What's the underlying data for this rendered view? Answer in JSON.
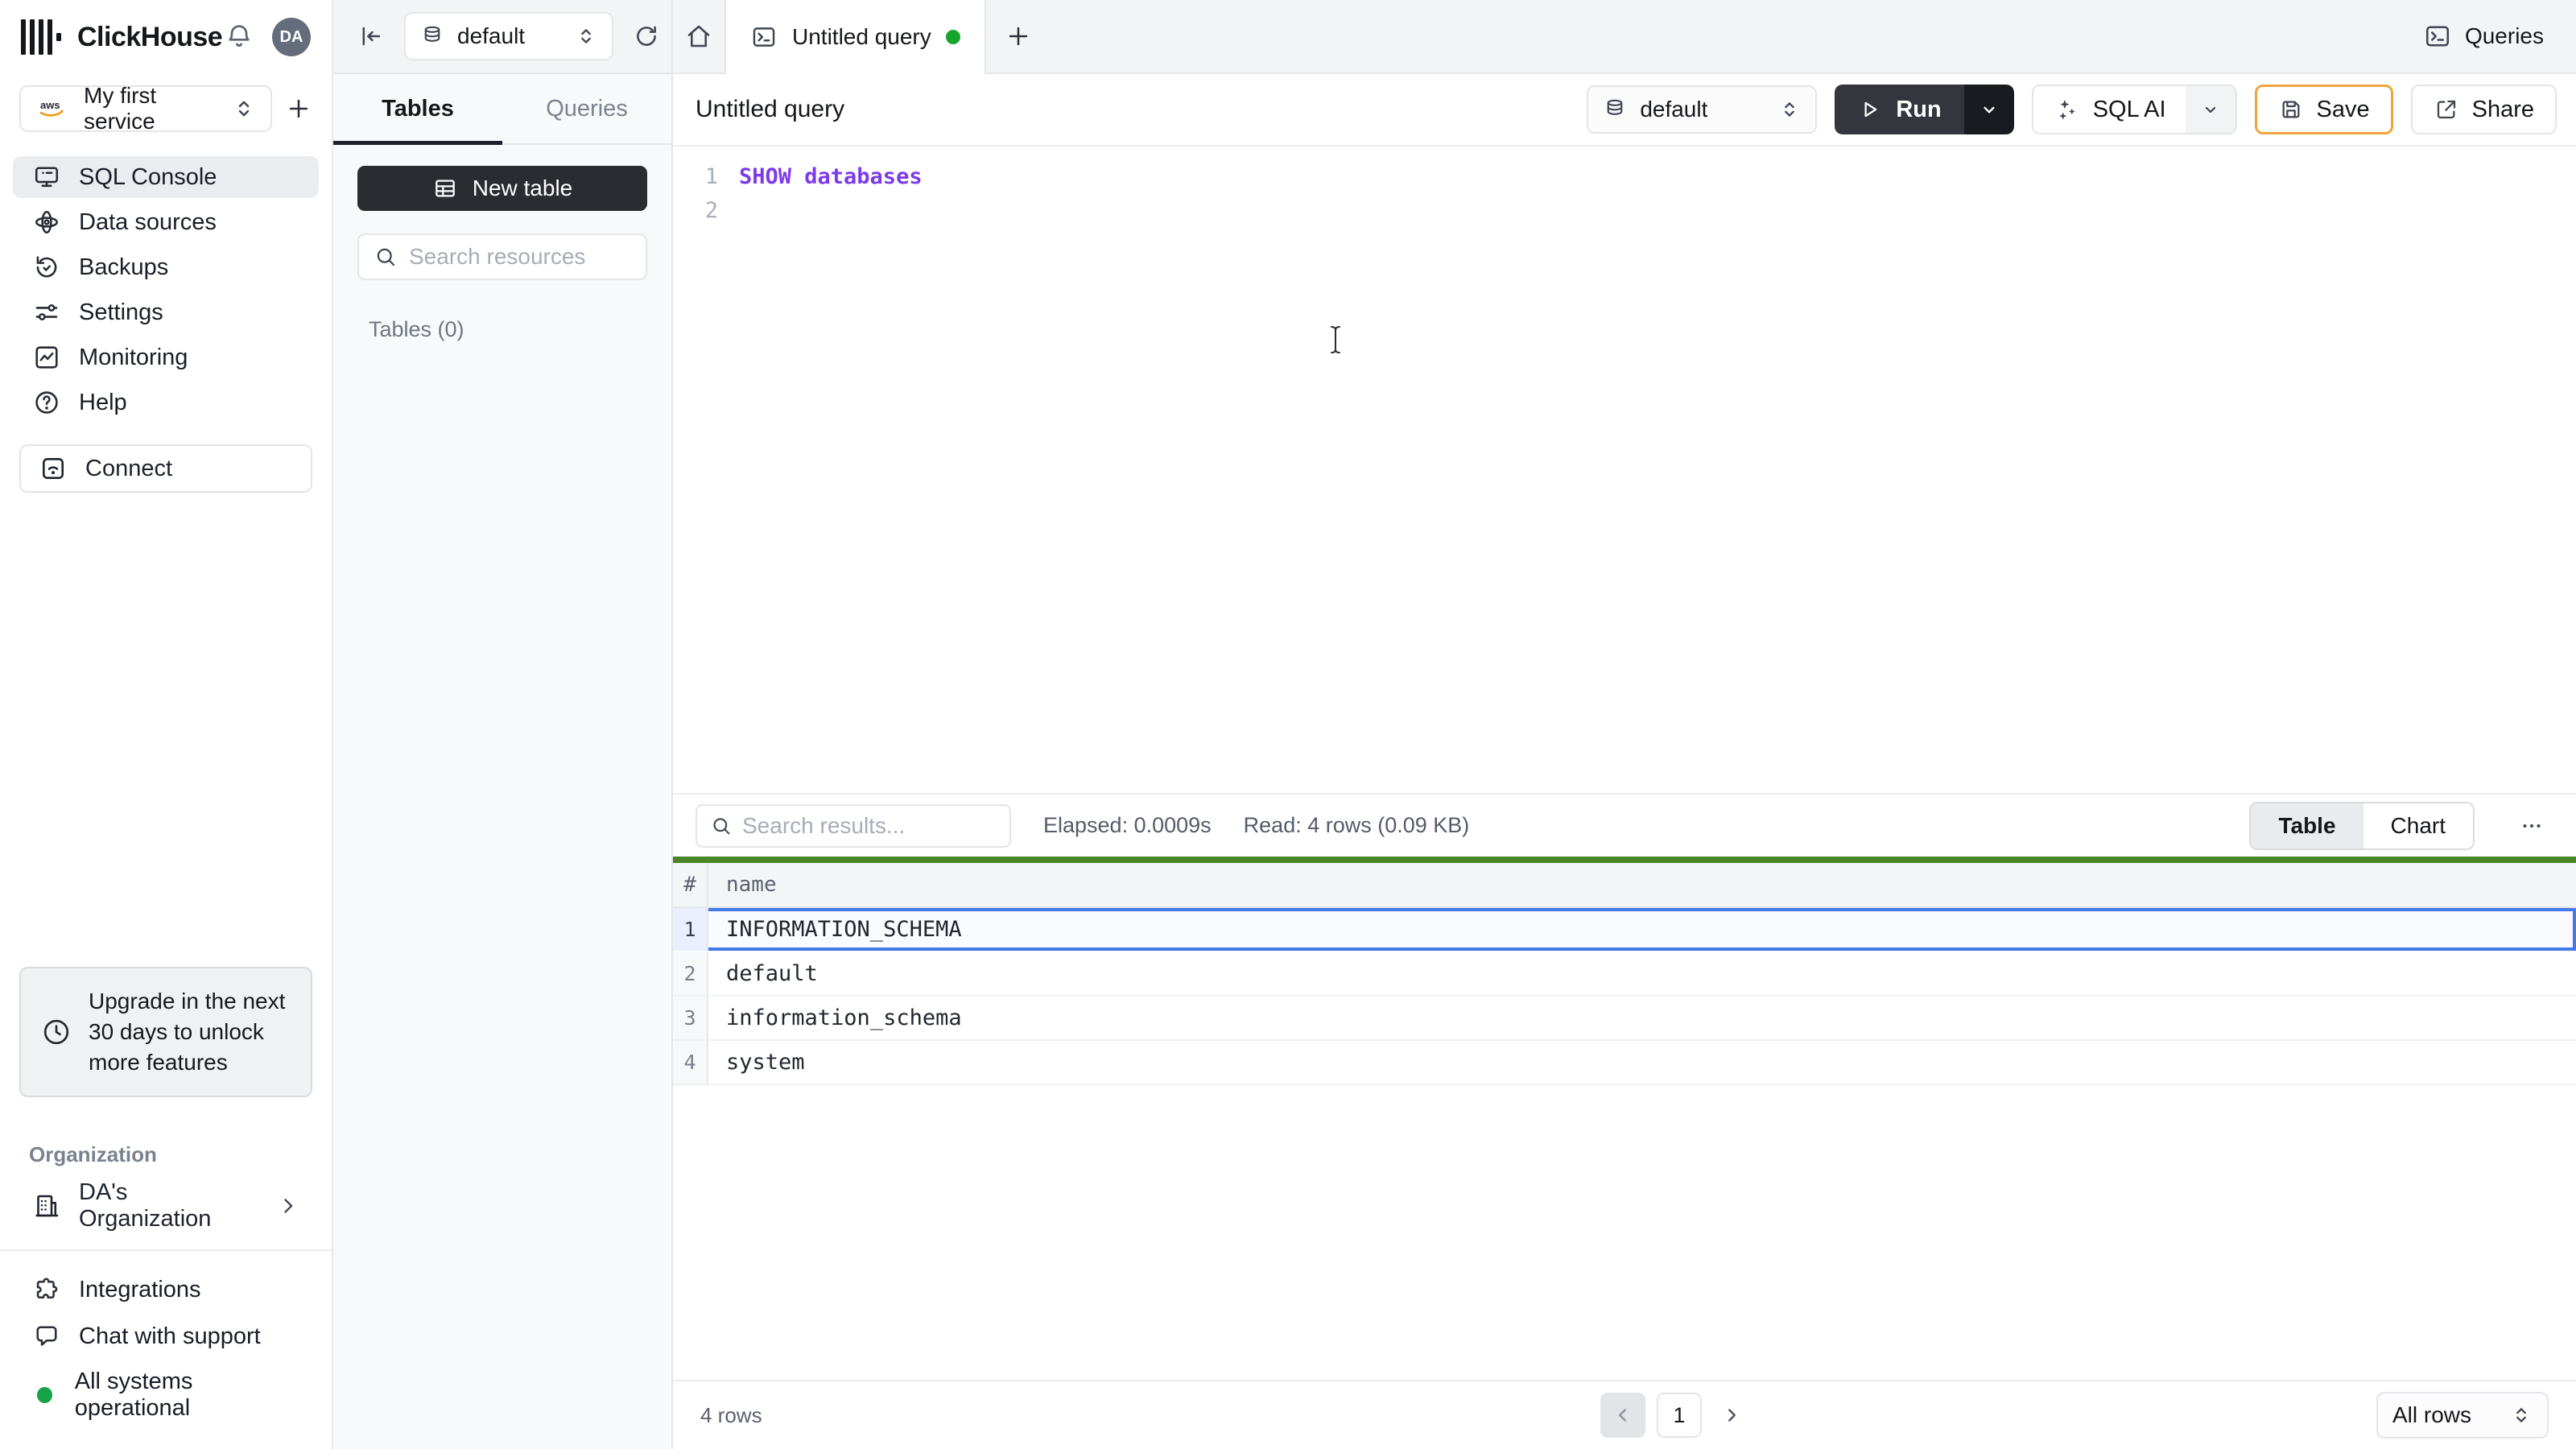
{
  "brand": {
    "name": "ClickHouse",
    "avatar_initials": "DA"
  },
  "sidebar": {
    "service_selector": {
      "label": "My first service",
      "provider_icon": "aws-icon"
    },
    "nav": [
      {
        "label": "SQL Console",
        "icon": "monitor-icon",
        "active": true
      },
      {
        "label": "Data sources",
        "icon": "atom-icon"
      },
      {
        "label": "Backups",
        "icon": "history-icon"
      },
      {
        "label": "Settings",
        "icon": "sliders-icon"
      },
      {
        "label": "Monitoring",
        "icon": "chart-square-icon"
      },
      {
        "label": "Help",
        "icon": "help-circle-icon"
      }
    ],
    "connect_label": "Connect",
    "upgrade_notice": "Upgrade in the next 30 days to unlock more features",
    "organization_section_label": "Organization",
    "organization_name": "DA's Organization",
    "footer": {
      "integrations": "Integrations",
      "chat_support": "Chat with support",
      "status": "All systems operational"
    }
  },
  "topbar": {
    "database_selector": "default",
    "active_tab": "Untitled query",
    "queries_button": "Queries"
  },
  "explorer": {
    "tab_tables": "Tables",
    "tab_queries": "Queries",
    "new_table_label": "New table",
    "search_placeholder": "Search resources",
    "tables_count": "Tables (0)"
  },
  "query": {
    "title": "Untitled query",
    "database_selector": "default",
    "run_label": "Run",
    "sql_ai_label": "SQL AI",
    "save_label": "Save",
    "share_label": "Share",
    "lines": [
      {
        "number": "1",
        "code": "SHOW databases"
      },
      {
        "number": "2",
        "code": ""
      }
    ]
  },
  "results": {
    "search_placeholder": "Search results...",
    "elapsed": "Elapsed: 0.0009s",
    "read": "Read: 4 rows (0.09 KB)",
    "view_table": "Table",
    "view_chart": "Chart",
    "columns": {
      "index": "#",
      "name": "name"
    },
    "rows": [
      {
        "n": "1",
        "name": "INFORMATION_SCHEMA",
        "selected": true
      },
      {
        "n": "2",
        "name": "default"
      },
      {
        "n": "3",
        "name": "information_schema"
      },
      {
        "n": "4",
        "name": "system"
      }
    ],
    "footer": {
      "row_count": "4 rows",
      "page": "1",
      "page_size": "All rows"
    }
  },
  "colors": {
    "accent_green_bar": "#4a8627",
    "selected_row_blue": "#4379e8",
    "save_border_amber": "#f0a43c",
    "code_keyword_purple": "#7c3aed",
    "status_green": "#17a34a"
  }
}
